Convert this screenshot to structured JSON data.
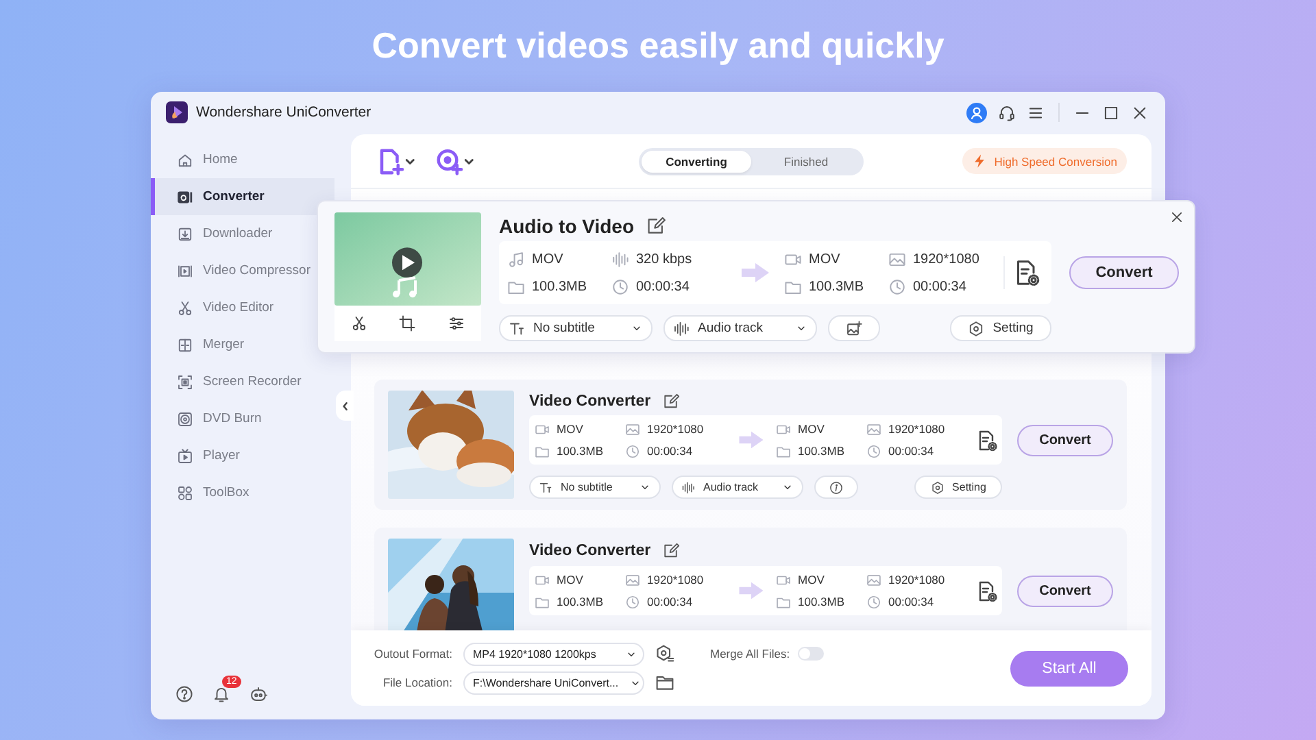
{
  "headline": "Convert videos easily and quickly",
  "window": {
    "title": "Wondershare UniConverter"
  },
  "sidebar": {
    "items": [
      {
        "label": "Home",
        "selected": false
      },
      {
        "label": "Converter",
        "selected": true
      },
      {
        "label": "Downloader",
        "selected": false
      },
      {
        "label": "Video Compressor",
        "selected": false
      },
      {
        "label": "Video Editor",
        "selected": false
      },
      {
        "label": "Merger",
        "selected": false
      },
      {
        "label": "Screen Recorder",
        "selected": false
      },
      {
        "label": "DVD Burn",
        "selected": false
      },
      {
        "label": "Player",
        "selected": false
      },
      {
        "label": "ToolBox",
        "selected": false
      }
    ],
    "notification_count": "12"
  },
  "toolbar": {
    "tabs": [
      {
        "label": "Converting",
        "selected": true
      },
      {
        "label": "Finished",
        "selected": false
      }
    ],
    "high_speed_label": "High Speed Conversion"
  },
  "popup": {
    "kind": "audio",
    "title": "Audio to Video",
    "source": {
      "format": "MOV",
      "spec": "320 kbps",
      "size": "100.3MB",
      "duration": "00:00:34"
    },
    "target": {
      "format": "MOV",
      "spec": "1920*1080",
      "size": "100.3MB",
      "duration": "00:00:34"
    },
    "subtitle": "No subtitle",
    "audio_track": "Audio track",
    "setting": "Setting",
    "convert": "Convert"
  },
  "files": [
    {
      "kind": "video",
      "title": "Video Converter",
      "source": {
        "format": "MOV",
        "spec": "1920*1080",
        "size": "100.3MB",
        "duration": "00:00:34"
      },
      "target": {
        "format": "MOV",
        "spec": "1920*1080",
        "size": "100.3MB",
        "duration": "00:00:34"
      },
      "subtitle": "No subtitle",
      "audio_track": "Audio track",
      "setting": "Setting",
      "convert": "Convert"
    },
    {
      "kind": "video",
      "title": "Video Converter",
      "source": {
        "format": "MOV",
        "spec": "1920*1080",
        "size": "100.3MB",
        "duration": "00:00:34"
      },
      "target": {
        "format": "MOV",
        "spec": "1920*1080",
        "size": "100.3MB",
        "duration": "00:00:34"
      },
      "convert": "Convert"
    }
  ],
  "bottom_bar": {
    "output_format_label": "Outout Format:",
    "output_format": "MP4 1920*1080 1200kps",
    "file_location_label": "File Location:",
    "file_location": "F:\\Wondershare UniConvert...",
    "merge_label": "Merge All Files:",
    "merge_on": false,
    "start_all": "Start All"
  }
}
